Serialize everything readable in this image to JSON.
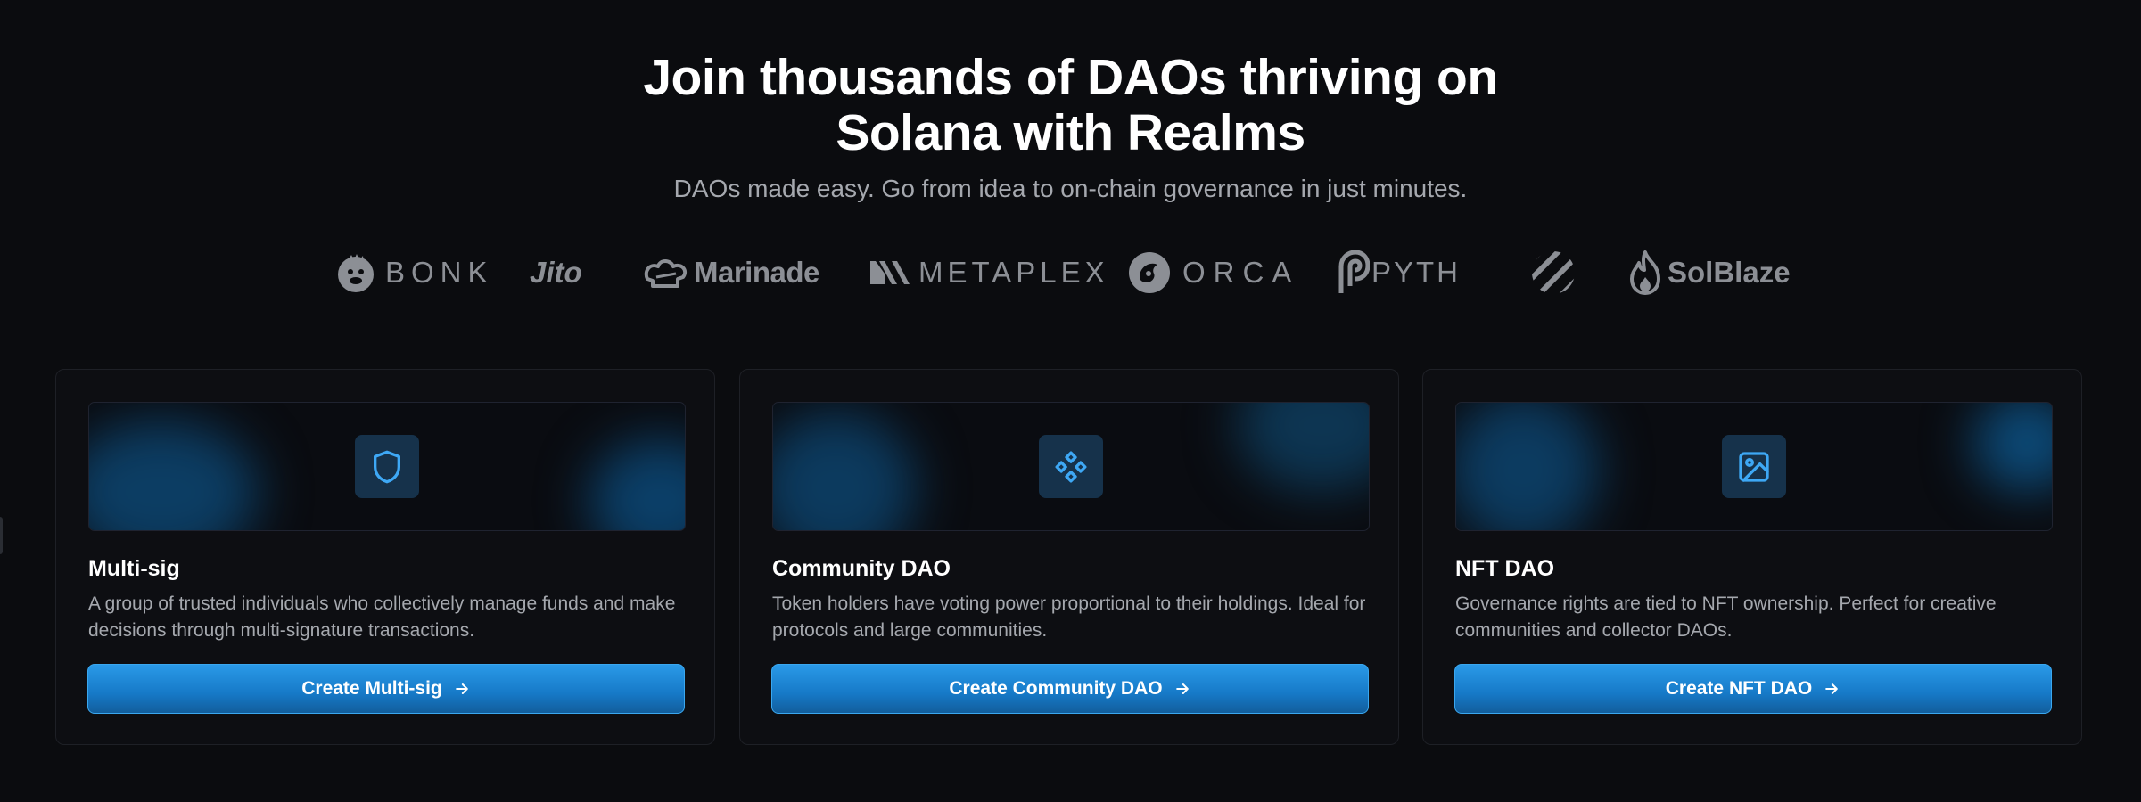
{
  "hero": {
    "title_line1": "Join thousands of DAOs thriving on",
    "title_line2": "Solana with Realms",
    "subtitle": "DAOs made easy. Go from idea to on-chain governance in just minutes."
  },
  "logos": [
    {
      "name": "BONK",
      "icon": "bonk-dog-icon"
    },
    {
      "name": "Jito",
      "icon": ""
    },
    {
      "name": "Marinade",
      "icon": "marinade-chef-hat-icon"
    },
    {
      "name": "METAPLEX",
      "icon": "metaplex-m-icon"
    },
    {
      "name": "ORCA",
      "icon": "orca-whale-icon"
    },
    {
      "name": "PYTH",
      "icon": "pyth-p-icon"
    },
    {
      "name": "",
      "icon": "striped-circle-logo-icon"
    },
    {
      "name": "SolBlaze",
      "icon": "flame-icon"
    }
  ],
  "cards": [
    {
      "icon": "shield-icon",
      "title": "Multi-sig",
      "description": "A group of trusted individuals who collectively manage funds and make decisions through multi-signature transactions.",
      "button": "Create Multi-sig"
    },
    {
      "icon": "diamond-nodes-icon",
      "title": "Community DAO",
      "description": "Token holders have voting power proportional to their holdings. Ideal for protocols and large communities.",
      "button": "Create Community DAO"
    },
    {
      "icon": "image-icon",
      "title": "NFT DAO",
      "description": "Governance rights are tied to NFT ownership. Perfect for creative communities and collector DAOs.",
      "button": "Create NFT DAO"
    }
  ],
  "colors": {
    "background": "#0b0c0f",
    "accent": "#2a9ae8",
    "icon_accent": "#3ea8f5",
    "muted_text": "#a5a8ae",
    "logo_gray": "#8c8f95"
  }
}
